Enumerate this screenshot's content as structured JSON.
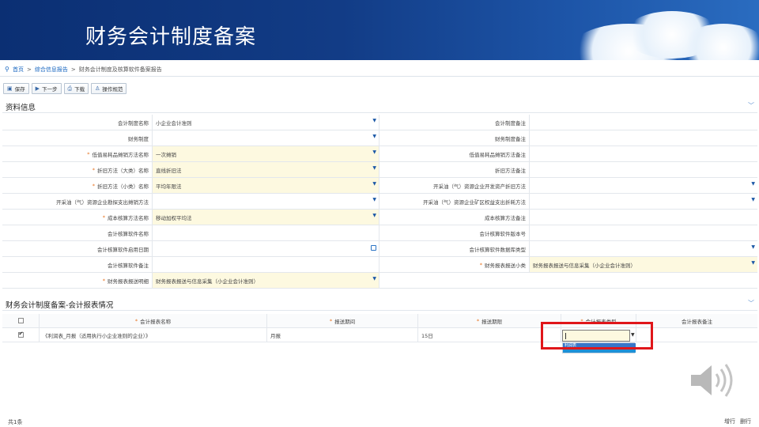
{
  "banner": {
    "title": "财务会计制度备案"
  },
  "breadcrumb": {
    "home": "首页",
    "level2": "综合信息报告",
    "level3": "财务会计制度及核算软件备案报告"
  },
  "toolbar": {
    "save": "保存",
    "next": "下一步",
    "download": "下载",
    "guide": "操作规范"
  },
  "info_section": {
    "title": "资料信息"
  },
  "form_rows": [
    {
      "l_label": "会计制度名称",
      "l_req": false,
      "l_value": "小企业会计准则",
      "l_yellow": false,
      "l_dd": true,
      "r_label": "会计制度备注",
      "r_req": false,
      "r_value": "",
      "r_yellow": false,
      "r_dd": false
    },
    {
      "l_label": "财务制度",
      "l_req": false,
      "l_value": "",
      "l_yellow": false,
      "l_dd": true,
      "r_label": "财务制度备注",
      "r_req": false,
      "r_value": "",
      "r_yellow": false,
      "r_dd": false
    },
    {
      "l_label": "低值易耗品摊销方法名称",
      "l_req": true,
      "l_value": "一次摊销",
      "l_yellow": true,
      "l_dd": true,
      "r_label": "低值易耗品摊销方法备注",
      "r_req": false,
      "r_value": "",
      "r_yellow": false,
      "r_dd": false
    },
    {
      "l_label": "折旧方法（大类）名称",
      "l_req": true,
      "l_value": "直线折旧法",
      "l_yellow": true,
      "l_dd": true,
      "r_label": "折旧方法备注",
      "r_req": false,
      "r_value": "",
      "r_yellow": false,
      "r_dd": false
    },
    {
      "l_label": "折旧方法（小类）名称",
      "l_req": true,
      "l_value": "平均年限法",
      "l_yellow": true,
      "l_dd": true,
      "r_label": "开采油（气）资源企业开发资产折旧方法",
      "r_req": false,
      "r_value": "",
      "r_yellow": false,
      "r_dd": true
    },
    {
      "l_label": "开采油（气）资源企业勘探支出摊销方法",
      "l_req": false,
      "l_value": "",
      "l_yellow": false,
      "l_dd": true,
      "r_label": "开采油（气）资源企业矿区权益支出折耗方法",
      "r_req": false,
      "r_value": "",
      "r_yellow": false,
      "r_dd": true
    },
    {
      "l_label": "成本核算方法名称",
      "l_req": true,
      "l_value": "移动加权平均法",
      "l_yellow": true,
      "l_dd": true,
      "r_label": "成本核算方法备注",
      "r_req": false,
      "r_value": "",
      "r_yellow": false,
      "r_dd": false
    },
    {
      "l_label": "会计核算软件名称",
      "l_req": false,
      "l_value": "",
      "l_yellow": false,
      "l_dd": false,
      "r_label": "会计核算软件版本号",
      "r_req": false,
      "r_value": "",
      "r_yellow": false,
      "r_dd": false
    },
    {
      "l_label": "会计核算软件启用日期",
      "l_req": false,
      "l_value": "",
      "l_yellow": false,
      "l_dd": false,
      "l_cal": true,
      "r_label": "会计核算软件数据库类型",
      "r_req": false,
      "r_value": "",
      "r_yellow": false,
      "r_dd": true
    },
    {
      "l_label": "会计核算软件备注",
      "l_req": false,
      "l_value": "",
      "l_yellow": false,
      "l_dd": false,
      "r_label": "财务报表报送小类",
      "r_req": true,
      "r_value": "财务报表报送与信息采集（小企业会计准则）",
      "r_yellow": true,
      "r_dd": true
    },
    {
      "l_label": "财务报表报送明细",
      "l_req": true,
      "l_value": "财务报表报送与信息采集（小企业会计准则）",
      "l_yellow": true,
      "l_dd": true,
      "r_label": "",
      "r_req": false,
      "r_value": "",
      "r_yellow": false,
      "r_dd": false,
      "r_blank": true
    }
  ],
  "report_section": {
    "title": "财务会计制度备案-会计报表情况"
  },
  "table": {
    "headers": {
      "name": "会计报表名称",
      "period": "报送期间",
      "deadline": "报送期限",
      "type": "会计报表类型",
      "note": "会计报表备注"
    },
    "rows": [
      {
        "checked": true,
        "name": "《利润表_月报（适用执行小企业准则的企业）》",
        "period": "月报",
        "deadline": "15日",
        "type": "",
        "note": ""
      }
    ],
    "dropdown_option": "利润表"
  },
  "footer": {
    "count": "共1条",
    "add_row": "增行",
    "delete_row": "删行"
  }
}
